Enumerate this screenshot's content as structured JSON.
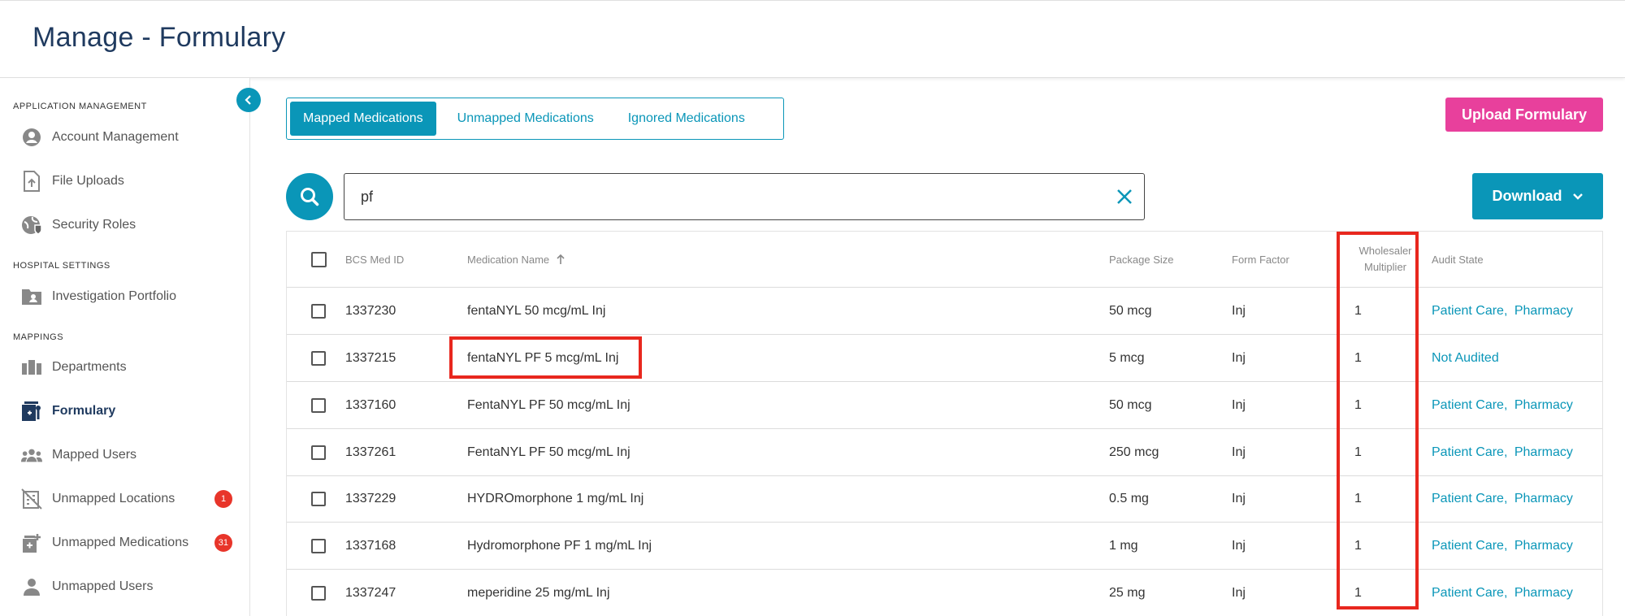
{
  "header": {
    "title": "Manage - Formulary"
  },
  "sidebar": {
    "sections": [
      {
        "label": "Application Management"
      },
      {
        "label": "Hospital Settings"
      },
      {
        "label": "Mappings"
      }
    ],
    "items": [
      {
        "label": "Account Management",
        "icon": "account-circle-icon"
      },
      {
        "label": "File Uploads",
        "icon": "file-upload-icon"
      },
      {
        "label": "Security Roles",
        "icon": "security-globe-icon"
      },
      {
        "label": "Investigation Portfolio",
        "icon": "folder-person-icon"
      },
      {
        "label": "Departments",
        "icon": "departments-icon"
      },
      {
        "label": "Formulary",
        "icon": "formulary-icon",
        "active": true
      },
      {
        "label": "Mapped Users",
        "icon": "users-group-icon"
      },
      {
        "label": "Unmapped Locations",
        "icon": "location-off-icon",
        "badge": "1"
      },
      {
        "label": "Unmapped Medications",
        "icon": "medication-add-icon",
        "badge": "31"
      },
      {
        "label": "Unmapped Users",
        "icon": "person-icon"
      }
    ]
  },
  "tabs": [
    {
      "label": "Mapped Medications",
      "active": true
    },
    {
      "label": "Unmapped Medications"
    },
    {
      "label": "Ignored Medications"
    }
  ],
  "upload_label": "Upload Formulary",
  "download_label": "Download",
  "search": {
    "value": "pf"
  },
  "table": {
    "headers": {
      "id": "BCS Med ID",
      "name": "Medication Name",
      "package": "Package Size",
      "form": "Form Factor",
      "wm_line1": "Wholesaler",
      "wm_line2": "Multiplier",
      "audit": "Audit State"
    },
    "rows": [
      {
        "id": "1337230",
        "name": "fentaNYL 50 mcg/mL Inj",
        "package": "50 mcg",
        "form": "Inj",
        "wm": "1",
        "audit": [
          "Patient Care,",
          "Pharmacy"
        ]
      },
      {
        "id": "1337215",
        "name": "fentaNYL PF 5 mcg/mL Inj",
        "package": "5 mcg",
        "form": "Inj",
        "wm": "1",
        "audit": [
          "Not Audited"
        ]
      },
      {
        "id": "1337160",
        "name": "FentaNYL PF 50 mcg/mL Inj",
        "package": "50 mcg",
        "form": "Inj",
        "wm": "1",
        "audit": [
          "Patient Care,",
          "Pharmacy"
        ]
      },
      {
        "id": "1337261",
        "name": "FentaNYL PF 50 mcg/mL Inj",
        "package": "250 mcg",
        "form": "Inj",
        "wm": "1",
        "audit": [
          "Patient Care,",
          "Pharmacy"
        ]
      },
      {
        "id": "1337229",
        "name": "HYDROmorphone 1 mg/mL Inj",
        "package": "0.5 mg",
        "form": "Inj",
        "wm": "1",
        "audit": [
          "Patient Care,",
          "Pharmacy"
        ]
      },
      {
        "id": "1337168",
        "name": "Hydromorphone PF 1 mg/mL Inj",
        "package": "1 mg",
        "form": "Inj",
        "wm": "1",
        "audit": [
          "Patient Care,",
          "Pharmacy"
        ]
      },
      {
        "id": "1337247",
        "name": "meperidine 25 mg/mL Inj",
        "package": "25 mg",
        "form": "Inj",
        "wm": "1",
        "audit": [
          "Patient Care,",
          "Pharmacy"
        ]
      }
    ]
  },
  "colors": {
    "accent": "#0a96b8",
    "upload": "#e8409c",
    "highlight": "#e8271e",
    "title": "#1f3a5f"
  }
}
